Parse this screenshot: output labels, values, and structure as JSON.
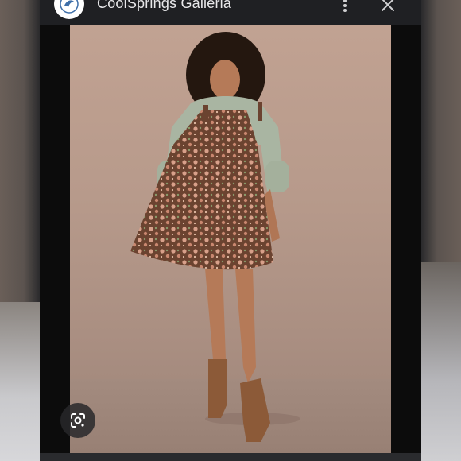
{
  "header": {
    "site_name": "CoolSprings Galleria"
  },
  "icons": {
    "logo": "site-logo-icon",
    "menu": "more-vert-icon",
    "close": "close-icon",
    "lens": "google-lens-icon"
  },
  "colors": {
    "topbar": "#1f2023",
    "panel": "#111213",
    "photo_bg": "#b79a8b"
  }
}
